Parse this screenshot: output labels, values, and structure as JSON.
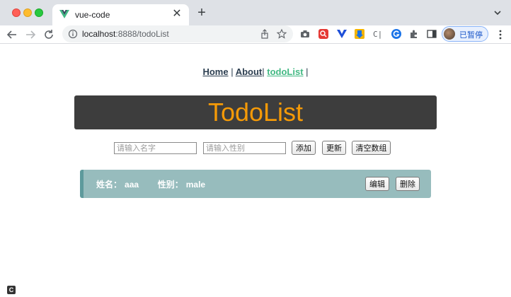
{
  "browser": {
    "tab_title": "vue-code",
    "url_host": "localhost",
    "url_rest": ":8888/todoList",
    "profile_label": "已暂停"
  },
  "nav": {
    "items": [
      {
        "label": "Home",
        "active": false
      },
      {
        "label": "About",
        "active": false
      },
      {
        "label": "todoList",
        "active": true
      }
    ],
    "separator": "|"
  },
  "banner": {
    "title": "TodoList"
  },
  "form": {
    "name_placeholder": "请输入名字",
    "gender_placeholder": "请输入性别",
    "add_label": "添加",
    "update_label": "更新",
    "clear_label": "清空数组"
  },
  "todos": [
    {
      "name_label": "姓名：",
      "name": "aaa",
      "gender_label": "性别：",
      "gender": "male",
      "edit_label": "编辑",
      "delete_label": "删除"
    }
  ],
  "colors": {
    "accent_active_link": "#42b983",
    "banner_bg": "#3d3d3d",
    "banner_title": "#f59a07",
    "item_bg": "#97bcbd",
    "item_border": "#5e9a9c"
  },
  "corner_badge": "C"
}
